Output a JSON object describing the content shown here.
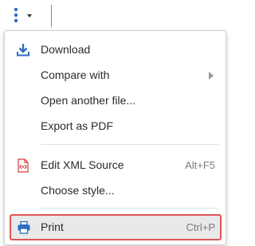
{
  "menu": {
    "items": [
      {
        "label": "Download",
        "icon": "download-icon"
      },
      {
        "label": "Compare with",
        "icon": "",
        "submenu": true
      },
      {
        "label": "Open another file...",
        "icon": ""
      },
      {
        "label": "Export as PDF",
        "icon": ""
      },
      {
        "label": "Edit XML Source",
        "icon": "xml-source-icon",
        "shortcut": "Alt+F5"
      },
      {
        "label": "Choose style...",
        "icon": ""
      },
      {
        "label": "Print",
        "icon": "printer-icon",
        "shortcut": "Ctrl+P",
        "highlighted": true
      }
    ]
  },
  "colors": {
    "accent_blue": "#2b6cc4",
    "highlight_border": "#e05555",
    "highlight_bg": "#e9e9e9"
  }
}
